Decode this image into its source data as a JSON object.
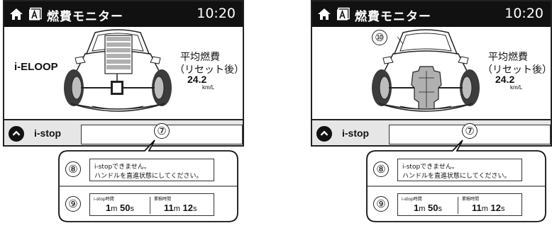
{
  "screen": {
    "title": "燃費モニター",
    "clock": "10:20"
  },
  "left": {
    "feature_label": "i-ELOOP",
    "fuel_title": "平均燃費",
    "fuel_subtitle": "（リセット後）",
    "fuel_value": "24.2",
    "fuel_unit": "km/L"
  },
  "right": {
    "fuel_title": "平均燃費",
    "fuel_subtitle": "（リセット後）",
    "fuel_value": "24.2",
    "fuel_unit": "km/L",
    "callout_car": "⑩"
  },
  "bottom": {
    "istop_label": "i-stop"
  },
  "callouts": {
    "status": "⑦",
    "message": "⑧",
    "times": "⑨"
  },
  "message": {
    "line1": "i-stopできません。",
    "line2": "ハンドルを直進状態にしてください。"
  },
  "times": {
    "istop_label": "i-stop時間",
    "istop_min": "1",
    "istop_min_unit": "m",
    "istop_sec": "50",
    "istop_sec_unit": "s",
    "total_label": "累積時間",
    "total_min": "11",
    "total_min_unit": "m",
    "total_sec": "12",
    "total_sec_unit": "s"
  },
  "icons": {
    "home": "home-icon",
    "apps": "apps-icon",
    "toggle": "chevron-up-icon"
  },
  "colors": {
    "titlebar": "#111111",
    "bottombar": "#e6e6e6",
    "energy": "#b0b0b0"
  }
}
